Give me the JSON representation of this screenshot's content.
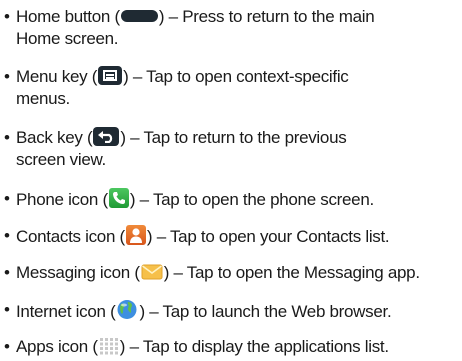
{
  "bullet": "•",
  "items": [
    {
      "term": "Home button",
      "open": " (",
      "close": ")",
      "desc1": " – Press to return to the main",
      "desc2": "Home screen.",
      "icon": "home-button-icon"
    },
    {
      "term": "Menu key",
      "open": " (",
      "close": ")",
      "desc1": " – Tap to open context-specific",
      "desc2": "menus.",
      "icon": "menu-key-icon"
    },
    {
      "term": "Back key",
      "open": " (",
      "close": ")",
      "desc1": " – Tap to return to the previous",
      "desc2": "screen view.",
      "icon": "back-key-icon"
    },
    {
      "term": "Phone icon",
      "open": " (",
      "close": ")",
      "desc1": " – Tap to open the phone screen.",
      "icon": "phone-icon"
    },
    {
      "term": "Contacts icon",
      "open": " (",
      "close": ")",
      "desc1": " – Tap to open your Contacts list.",
      "icon": "contacts-icon"
    },
    {
      "term": "Messaging icon",
      "open": " (",
      "close": ")",
      "desc1": " – Tap to open the Messaging app.",
      "icon": "messaging-icon"
    },
    {
      "term": "Internet icon",
      "open": " (",
      "close": ")",
      "desc1": " – Tap to launch the Web browser.",
      "icon": "internet-icon"
    },
    {
      "term": "Apps icon",
      "open": " (",
      "close": ")",
      "desc1": " – Tap to display the applications list.",
      "icon": "apps-icon"
    }
  ]
}
